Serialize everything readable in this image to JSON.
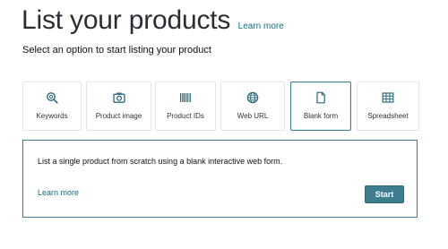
{
  "header": {
    "title": "List your products",
    "learn_more": "Learn more",
    "subtitle": "Select an option to start listing your product"
  },
  "options": [
    {
      "label": "Keywords",
      "icon": "magnifier-icon"
    },
    {
      "label": "Product image",
      "icon": "camera-icon"
    },
    {
      "label": "Product IDs",
      "icon": "barcode-icon"
    },
    {
      "label": "Web URL",
      "icon": "globe-icon"
    },
    {
      "label": "Blank form",
      "icon": "document-icon",
      "selected": true
    },
    {
      "label": "Spreadsheet",
      "icon": "spreadsheet-icon"
    }
  ],
  "panel": {
    "description": "List a single product from scratch using a blank interactive web form.",
    "learn_more": "Learn more",
    "start_label": "Start"
  },
  "colors": {
    "accent": "#3c7d8f",
    "link": "#0f6f83",
    "tile_border": "#e3e6e6"
  }
}
